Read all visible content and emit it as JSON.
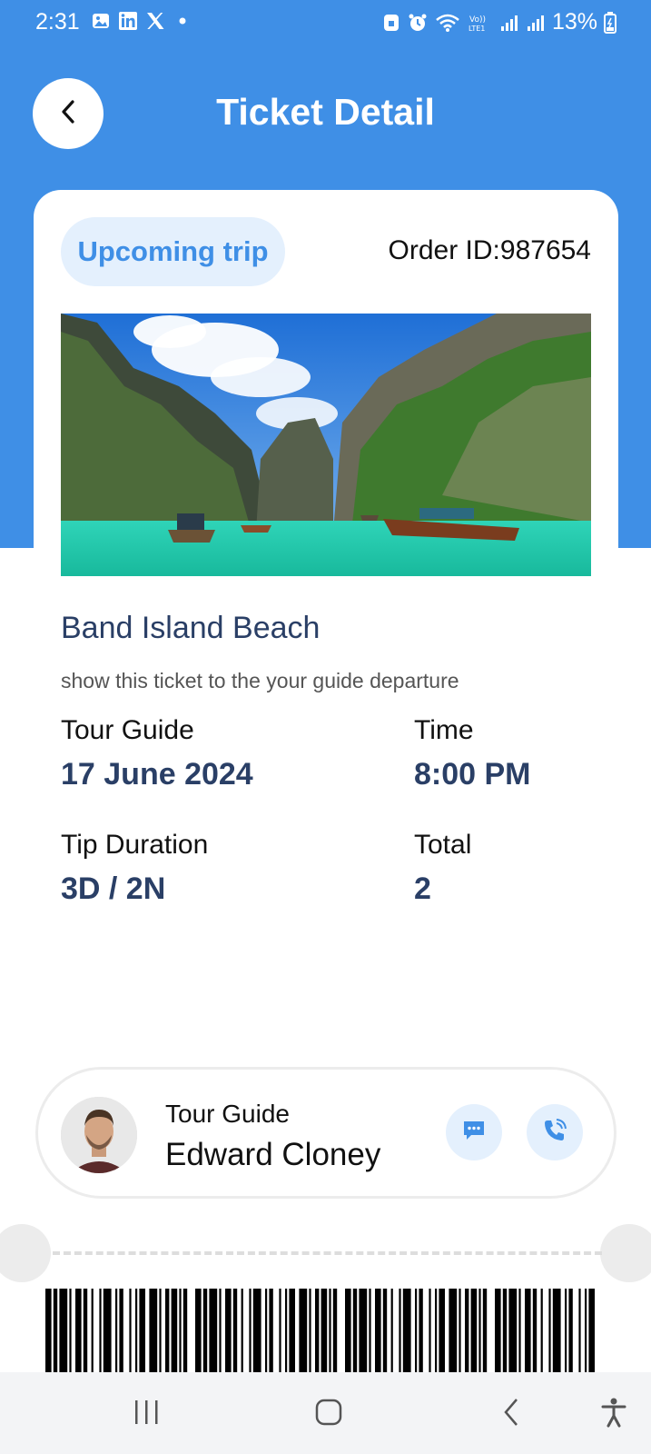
{
  "status_bar": {
    "time": "2:31",
    "battery": "13%",
    "left_icons": [
      "gallery-icon",
      "linkedin-icon",
      "x-icon",
      "dot-icon"
    ],
    "right_icons": [
      "security-icon",
      "alarm-icon",
      "wifi-icon",
      "volte-icon",
      "signal-icon",
      "signal-icon",
      "battery-icon"
    ]
  },
  "header": {
    "title": "Ticket Detail"
  },
  "ticket": {
    "status_badge": "Upcoming trip",
    "order_id": "Order ID:987654",
    "place_name": "Band Island Beach",
    "note": "show this ticket to the your guide departure",
    "details": [
      {
        "label": "Tour Guide",
        "value": "17 June 2024"
      },
      {
        "label": "Time",
        "value": "8:00 PM"
      },
      {
        "label": "Tip Duration",
        "value": "3D / 2N"
      },
      {
        "label": "Total",
        "value": "2"
      }
    ]
  },
  "guide": {
    "role": "Tour Guide",
    "name": "Edward Cloney"
  },
  "colors": {
    "primary": "#3f8fe6",
    "dark_text": "#2a3f66",
    "badge_bg": "#e4f0fd"
  }
}
